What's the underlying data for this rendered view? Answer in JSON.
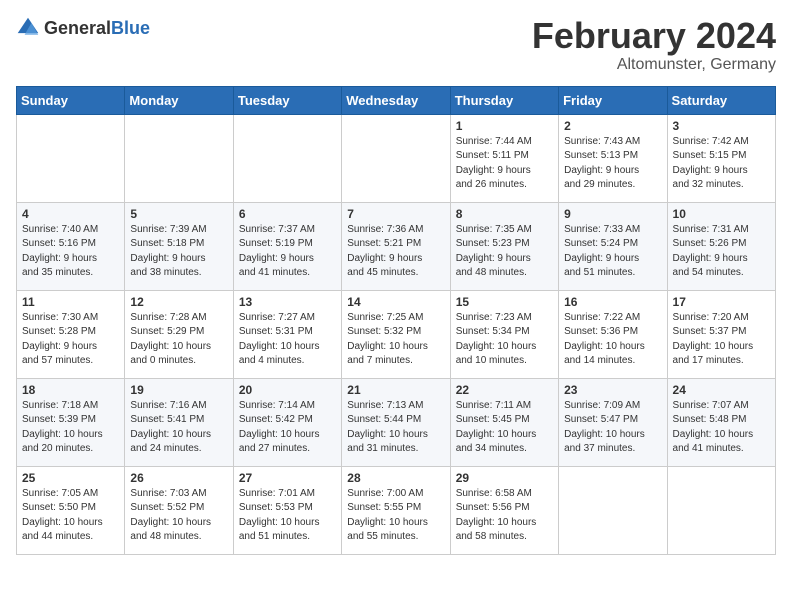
{
  "header": {
    "logo_general": "General",
    "logo_blue": "Blue",
    "month": "February 2024",
    "location": "Altomunster, Germany"
  },
  "weekdays": [
    "Sunday",
    "Monday",
    "Tuesday",
    "Wednesday",
    "Thursday",
    "Friday",
    "Saturday"
  ],
  "weeks": [
    [
      {
        "day": "",
        "info": ""
      },
      {
        "day": "",
        "info": ""
      },
      {
        "day": "",
        "info": ""
      },
      {
        "day": "",
        "info": ""
      },
      {
        "day": "1",
        "info": "Sunrise: 7:44 AM\nSunset: 5:11 PM\nDaylight: 9 hours\nand 26 minutes."
      },
      {
        "day": "2",
        "info": "Sunrise: 7:43 AM\nSunset: 5:13 PM\nDaylight: 9 hours\nand 29 minutes."
      },
      {
        "day": "3",
        "info": "Sunrise: 7:42 AM\nSunset: 5:15 PM\nDaylight: 9 hours\nand 32 minutes."
      }
    ],
    [
      {
        "day": "4",
        "info": "Sunrise: 7:40 AM\nSunset: 5:16 PM\nDaylight: 9 hours\nand 35 minutes."
      },
      {
        "day": "5",
        "info": "Sunrise: 7:39 AM\nSunset: 5:18 PM\nDaylight: 9 hours\nand 38 minutes."
      },
      {
        "day": "6",
        "info": "Sunrise: 7:37 AM\nSunset: 5:19 PM\nDaylight: 9 hours\nand 41 minutes."
      },
      {
        "day": "7",
        "info": "Sunrise: 7:36 AM\nSunset: 5:21 PM\nDaylight: 9 hours\nand 45 minutes."
      },
      {
        "day": "8",
        "info": "Sunrise: 7:35 AM\nSunset: 5:23 PM\nDaylight: 9 hours\nand 48 minutes."
      },
      {
        "day": "9",
        "info": "Sunrise: 7:33 AM\nSunset: 5:24 PM\nDaylight: 9 hours\nand 51 minutes."
      },
      {
        "day": "10",
        "info": "Sunrise: 7:31 AM\nSunset: 5:26 PM\nDaylight: 9 hours\nand 54 minutes."
      }
    ],
    [
      {
        "day": "11",
        "info": "Sunrise: 7:30 AM\nSunset: 5:28 PM\nDaylight: 9 hours\nand 57 minutes."
      },
      {
        "day": "12",
        "info": "Sunrise: 7:28 AM\nSunset: 5:29 PM\nDaylight: 10 hours\nand 0 minutes."
      },
      {
        "day": "13",
        "info": "Sunrise: 7:27 AM\nSunset: 5:31 PM\nDaylight: 10 hours\nand 4 minutes."
      },
      {
        "day": "14",
        "info": "Sunrise: 7:25 AM\nSunset: 5:32 PM\nDaylight: 10 hours\nand 7 minutes."
      },
      {
        "day": "15",
        "info": "Sunrise: 7:23 AM\nSunset: 5:34 PM\nDaylight: 10 hours\nand 10 minutes."
      },
      {
        "day": "16",
        "info": "Sunrise: 7:22 AM\nSunset: 5:36 PM\nDaylight: 10 hours\nand 14 minutes."
      },
      {
        "day": "17",
        "info": "Sunrise: 7:20 AM\nSunset: 5:37 PM\nDaylight: 10 hours\nand 17 minutes."
      }
    ],
    [
      {
        "day": "18",
        "info": "Sunrise: 7:18 AM\nSunset: 5:39 PM\nDaylight: 10 hours\nand 20 minutes."
      },
      {
        "day": "19",
        "info": "Sunrise: 7:16 AM\nSunset: 5:41 PM\nDaylight: 10 hours\nand 24 minutes."
      },
      {
        "day": "20",
        "info": "Sunrise: 7:14 AM\nSunset: 5:42 PM\nDaylight: 10 hours\nand 27 minutes."
      },
      {
        "day": "21",
        "info": "Sunrise: 7:13 AM\nSunset: 5:44 PM\nDaylight: 10 hours\nand 31 minutes."
      },
      {
        "day": "22",
        "info": "Sunrise: 7:11 AM\nSunset: 5:45 PM\nDaylight: 10 hours\nand 34 minutes."
      },
      {
        "day": "23",
        "info": "Sunrise: 7:09 AM\nSunset: 5:47 PM\nDaylight: 10 hours\nand 37 minutes."
      },
      {
        "day": "24",
        "info": "Sunrise: 7:07 AM\nSunset: 5:48 PM\nDaylight: 10 hours\nand 41 minutes."
      }
    ],
    [
      {
        "day": "25",
        "info": "Sunrise: 7:05 AM\nSunset: 5:50 PM\nDaylight: 10 hours\nand 44 minutes."
      },
      {
        "day": "26",
        "info": "Sunrise: 7:03 AM\nSunset: 5:52 PM\nDaylight: 10 hours\nand 48 minutes."
      },
      {
        "day": "27",
        "info": "Sunrise: 7:01 AM\nSunset: 5:53 PM\nDaylight: 10 hours\nand 51 minutes."
      },
      {
        "day": "28",
        "info": "Sunrise: 7:00 AM\nSunset: 5:55 PM\nDaylight: 10 hours\nand 55 minutes."
      },
      {
        "day": "29",
        "info": "Sunrise: 6:58 AM\nSunset: 5:56 PM\nDaylight: 10 hours\nand 58 minutes."
      },
      {
        "day": "",
        "info": ""
      },
      {
        "day": "",
        "info": ""
      }
    ]
  ]
}
